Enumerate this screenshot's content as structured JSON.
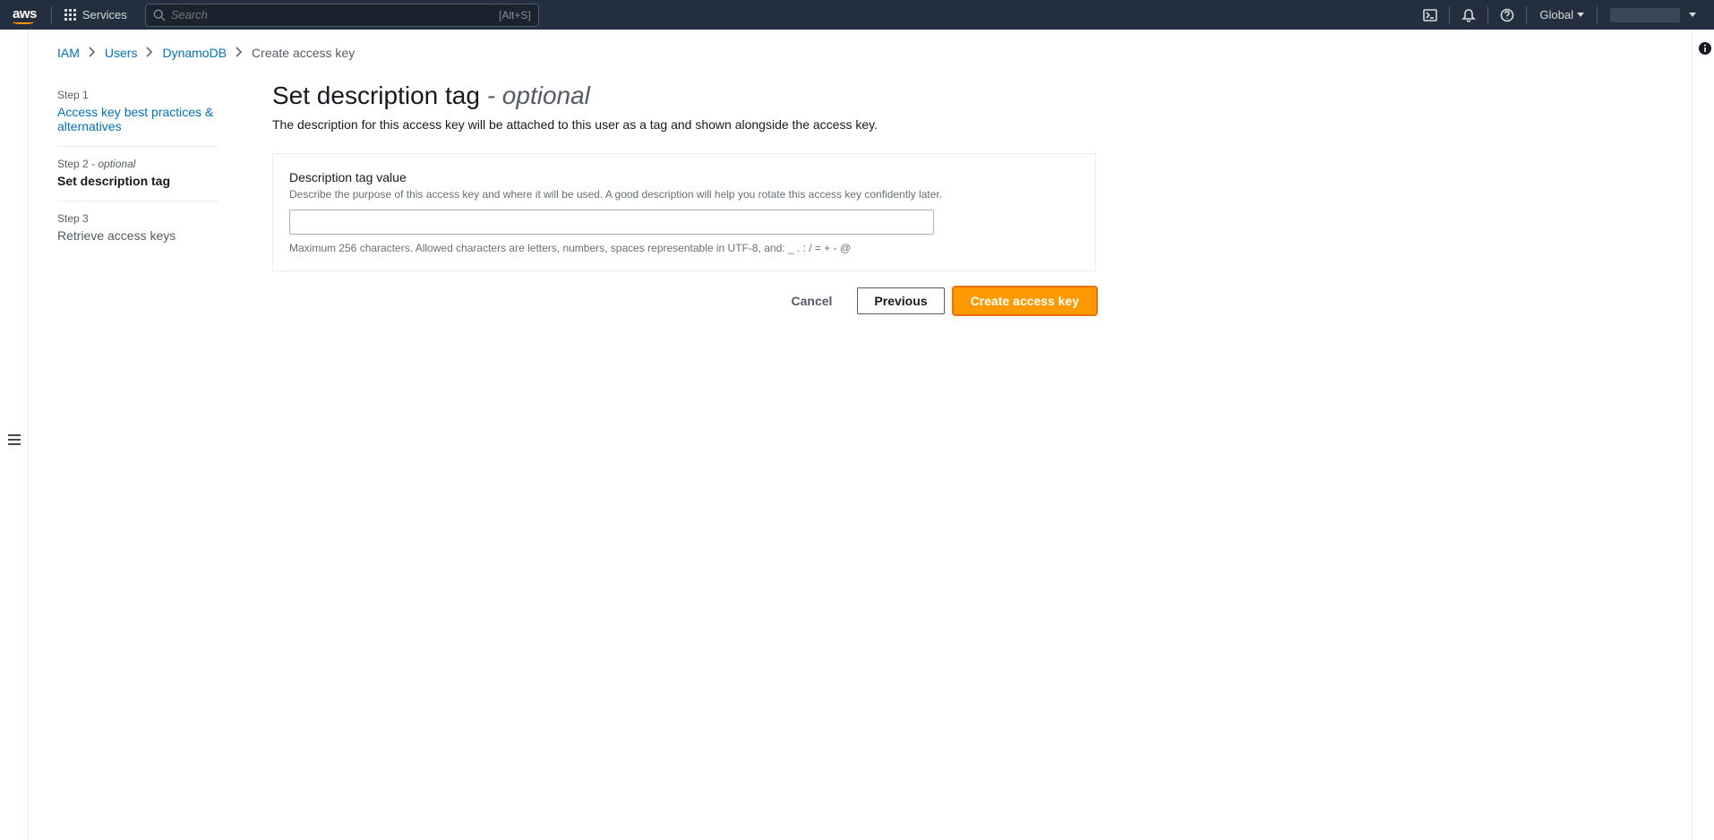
{
  "navbar": {
    "services_label": "Services",
    "search_placeholder": "Search",
    "search_kbd": "[Alt+S]",
    "region_label": "Global"
  },
  "breadcrumbs": {
    "items": [
      {
        "label": "IAM",
        "link": true
      },
      {
        "label": "Users",
        "link": true
      },
      {
        "label": "DynamoDB",
        "link": true
      },
      {
        "label": "Create access key",
        "link": false
      }
    ]
  },
  "steps": {
    "s1_label": "Step 1",
    "s1_title": "Access key best practices & alternatives",
    "s2_label_main": "Step 2",
    "s2_label_suffix": " - optional",
    "s2_title": "Set description tag",
    "s3_label": "Step 3",
    "s3_title": "Retrieve access keys"
  },
  "page": {
    "title_main": "Set description tag ",
    "title_suffix": "- optional",
    "description": "The description for this access key will be attached to this user as a tag and shown alongside the access key."
  },
  "form": {
    "field_label": "Description tag value",
    "field_help": "Describe the purpose of this access key and where it will be used. A good description will help you rotate this access key confidently later.",
    "field_value": "",
    "field_constraint": "Maximum 256 characters. Allowed characters are letters, numbers, spaces representable in UTF-8, and: _ . : / = + - @"
  },
  "actions": {
    "cancel": "Cancel",
    "previous": "Previous",
    "create": "Create access key"
  }
}
